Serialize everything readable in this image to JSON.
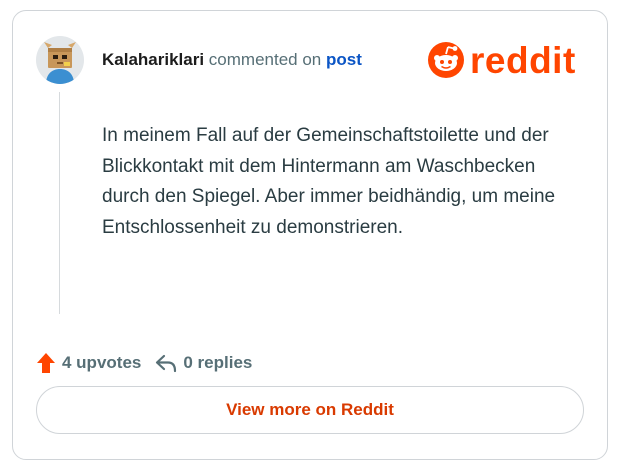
{
  "comment": {
    "author": "Kalahariklari",
    "action_text": "commented on",
    "target_link": "post",
    "body": "In meinem Fall auf der Gemeinschaftstoilette und der Blickkontakt mit dem Hintermann am Waschbecken durch den Spiegel. Aber immer beidhändig, um meine Entschlossenheit zu demonstrieren."
  },
  "brand": {
    "wordmark": "reddit",
    "color": "#ff4500"
  },
  "footer": {
    "upvotes_label": "4 upvotes",
    "replies_label": "0 replies",
    "upvote_icon": "upvote-arrow-icon",
    "reply_icon": "reply-arrow-icon"
  },
  "cta": {
    "label": "View more on Reddit"
  },
  "colors": {
    "link": "#0b55c5",
    "accent": "#ff4500",
    "cta_text": "#d93a00",
    "muted": "#576f76"
  }
}
